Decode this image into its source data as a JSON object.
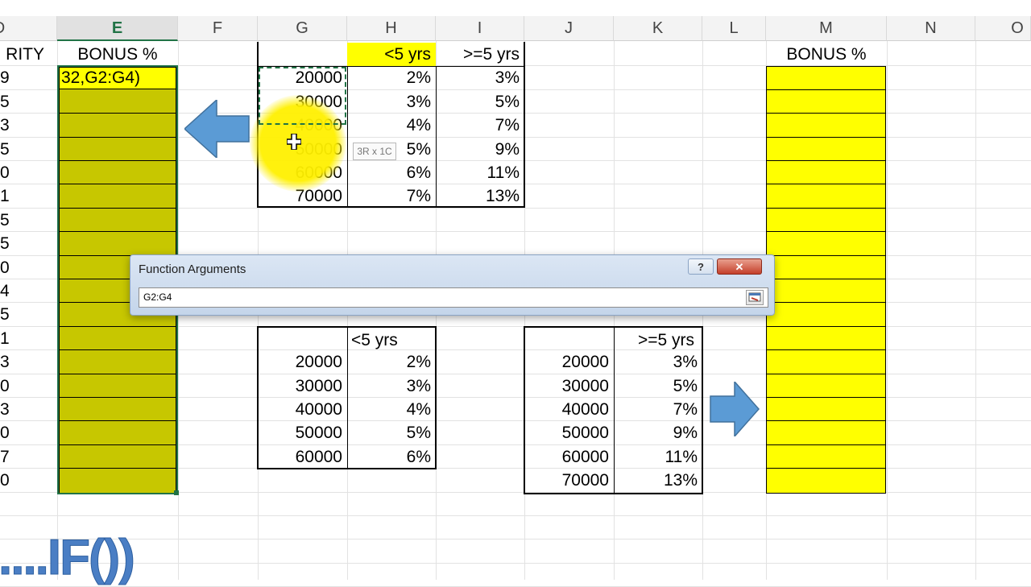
{
  "columns": [
    {
      "label": "D",
      "selected": false
    },
    {
      "label": "E",
      "selected": true
    },
    {
      "label": "F",
      "selected": false
    },
    {
      "label": "G",
      "selected": false
    },
    {
      "label": "H",
      "selected": false
    },
    {
      "label": "I",
      "selected": false
    },
    {
      "label": "J",
      "selected": false
    },
    {
      "label": "K",
      "selected": false
    },
    {
      "label": "L",
      "selected": false
    },
    {
      "label": "M",
      "selected": false
    },
    {
      "label": "N",
      "selected": false
    },
    {
      "label": "O",
      "selected": false
    }
  ],
  "col_d": {
    "header": "RITY",
    "values": [
      "9",
      "5",
      "3",
      "5",
      "0",
      "1",
      "5",
      "5",
      "0",
      "4",
      "5",
      "1",
      "3",
      "0",
      "3",
      "0",
      "7",
      "0"
    ]
  },
  "col_e": {
    "header": "BONUS %",
    "editing_text": "32,G2:G4)"
  },
  "top_table": {
    "headers": [
      "<5 yrs",
      ">=5 yrs"
    ],
    "rows": [
      {
        "g": "20000",
        "h": "2%",
        "i": "3%"
      },
      {
        "g": "30000",
        "h": "3%",
        "i": "5%"
      },
      {
        "g": "40000",
        "h": "4%",
        "i": "7%"
      },
      {
        "g": "50000",
        "h": "5%",
        "i": "9%"
      },
      {
        "g": "60000",
        "h": "6%",
        "i": "11%"
      },
      {
        "g": "70000",
        "h": "7%",
        "i": "13%"
      }
    ]
  },
  "selection_tooltip": "3R x 1C",
  "dialog": {
    "title": "Function Arguments",
    "help_label": "?",
    "close_label": "✕",
    "input_value": "G2:G4"
  },
  "lower_left_table": {
    "header": "<5 yrs",
    "rows": [
      {
        "g": "20000",
        "h": "2%"
      },
      {
        "g": "30000",
        "h": "3%"
      },
      {
        "g": "40000",
        "h": "4%"
      },
      {
        "g": "50000",
        "h": "5%"
      },
      {
        "g": "60000",
        "h": "6%"
      }
    ]
  },
  "lower_right_table": {
    "header": ">=5 yrs",
    "rows": [
      {
        "j": "20000",
        "k": "3%"
      },
      {
        "j": "30000",
        "k": "5%"
      },
      {
        "j": "40000",
        "k": "7%"
      },
      {
        "j": "50000",
        "k": "9%"
      },
      {
        "j": "60000",
        "k": "11%"
      },
      {
        "j": "70000",
        "k": "13%"
      }
    ]
  },
  "col_m": {
    "header": "BONUS %"
  },
  "watermark": "....IF())",
  "colors": {
    "yellow": "#ffff00",
    "olive_selected": "#c7c700",
    "arrow_blue": "#5b9bd5",
    "excel_green": "#217346"
  }
}
